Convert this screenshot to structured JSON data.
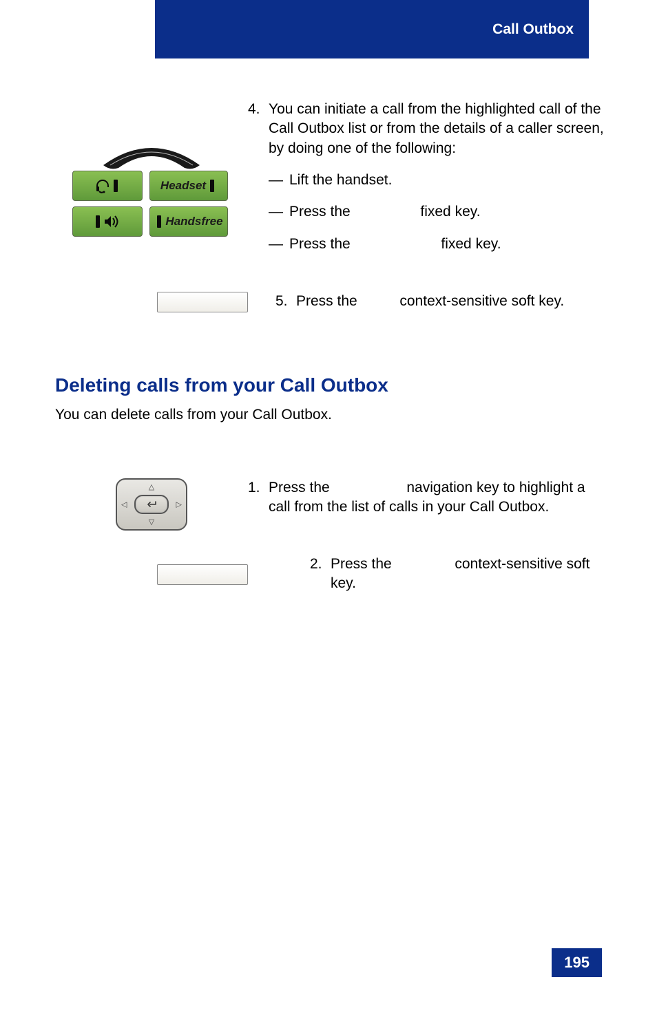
{
  "header": {
    "title": "Call Outbox"
  },
  "page_number": "195",
  "step4": {
    "num": "4.",
    "text": "You can initiate a call from the highlighted call of the Call Outbox list or from the details of a caller screen, by doing one of the following:",
    "sub1": "Lift the handset.",
    "sub2_a": "Press the ",
    "sub2_b": " fixed key.",
    "sub3_a": "Press the ",
    "sub3_b": " fixed key.",
    "key_labels": {
      "headset": "Headset",
      "handsfree": "Handsfree"
    }
  },
  "step5": {
    "num": "5.",
    "text_a": "Press the ",
    "text_b": " context-sensitive soft key."
  },
  "section": {
    "heading": "Deleting calls from your Call Outbox",
    "sub": "You can delete calls from your Call Outbox."
  },
  "del_step1": {
    "num": "1.",
    "text_a": "Press the ",
    "text_b": " navigation key to highlight a call from the list of calls in your Call Outbox."
  },
  "del_step2": {
    "num": "2.",
    "text_a": "Press the ",
    "text_b": " context-sensitive soft key."
  }
}
